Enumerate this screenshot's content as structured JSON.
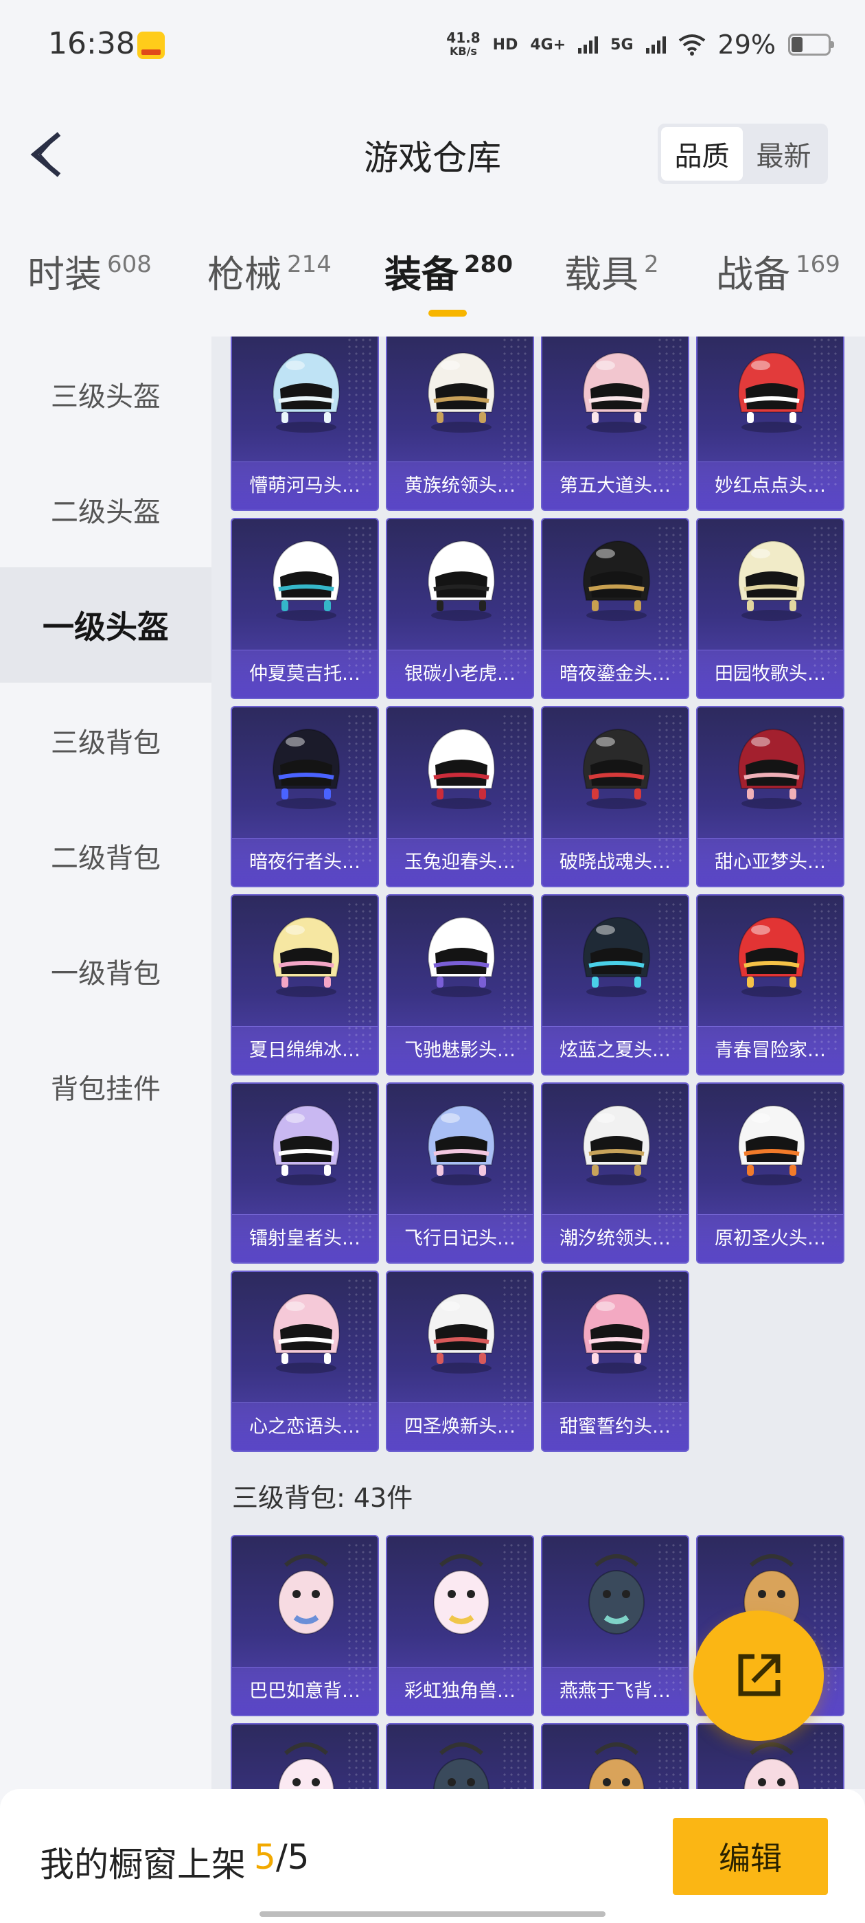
{
  "status_bar": {
    "time": "16:38",
    "net_speed_value": "41.8",
    "net_speed_unit": "KB/s",
    "hd": "HD",
    "net_4g": "4G+",
    "net_5g": "5G",
    "battery": "29%"
  },
  "header": {
    "title": "游戏仓库",
    "sort_options": [
      "品质",
      "最新"
    ]
  },
  "tabs": [
    {
      "label": "时装",
      "count": "608"
    },
    {
      "label": "枪械",
      "count": "214"
    },
    {
      "label": "装备",
      "count": "280"
    },
    {
      "label": "载具",
      "count": "2"
    },
    {
      "label": "战备",
      "count": "169"
    }
  ],
  "sidebar": {
    "items": [
      "三级头盔",
      "二级头盔",
      "一级头盔",
      "三级背包",
      "二级背包",
      "一级背包",
      "背包挂件"
    ]
  },
  "helmets": [
    "懵萌河马头…",
    "黄族统领头…",
    "第五大道头…",
    "妙红点点头…",
    "仲夏莫吉托…",
    "银碳小老虎…",
    "暗夜鎏金头…",
    "田园牧歌头…",
    "暗夜行者头…",
    "玉兔迎春头…",
    "破晓战魂头…",
    "甜心亚梦头…",
    "夏日绵绵冰…",
    "飞驰魅影头…",
    "炫蓝之夏头…",
    "青春冒险家…",
    "镭射皇者头…",
    "飞行日记头…",
    "潮汐统领头…",
    "原初圣火头…",
    "心之恋语头…",
    "四圣焕新头…",
    "甜蜜誓约头…"
  ],
  "backpack_section": {
    "title": "三级背包: 43件",
    "items": [
      "巴巴如意背…",
      "彩虹独角兽…",
      "燕燕于飞背…",
      ""
    ]
  },
  "bottom_bar": {
    "showcase_label": "我的橱窗上架",
    "showcase_current": "5",
    "showcase_sep": "/",
    "showcase_total": "5",
    "edit_label": "编辑"
  },
  "colors": {
    "accent": "#fbb614",
    "card_top": "#2d2a5e",
    "card_bottom": "#5446b4"
  }
}
